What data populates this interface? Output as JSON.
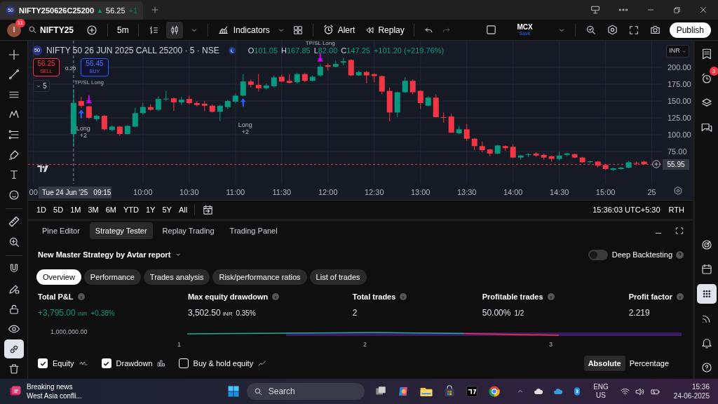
{
  "browser_tab": {
    "badge": "50",
    "title": "NIFTY250626C25200",
    "price": "56.25",
    "change": "+1"
  },
  "toolbar": {
    "avatar_letter": "I",
    "avatar_badge": "11",
    "symbol": "NIFTY25",
    "interval": "5m",
    "indicators": "Indicators",
    "alert": "Alert",
    "replay": "Replay",
    "exchange": "MCX",
    "exchange_sub": "Save",
    "publish": "Publish"
  },
  "left_tools": [
    {
      "selected": false
    },
    {
      "selected": false
    },
    {
      "selected": false
    },
    {
      "selected": false
    },
    {
      "selected": false
    },
    {
      "selected": false
    },
    {
      "selected": false
    },
    {
      "selected": false
    },
    {
      "selected": false
    },
    {
      "selected": false
    },
    {
      "selected": false
    },
    {
      "selected": false
    },
    {
      "selected": false
    },
    {
      "selected": false
    },
    {
      "selected": true
    },
    {
      "selected": false
    }
  ],
  "right_tools": [
    {
      "selected": false
    },
    {
      "selected": false,
      "badge": "3"
    },
    {
      "selected": false
    },
    {
      "selected": false
    },
    {
      "selected": false
    },
    {
      "selected": false
    },
    {
      "selected": true
    },
    {
      "selected": false
    },
    {
      "selected": false
    },
    {
      "selected": false
    }
  ],
  "chart": {
    "header": {
      "badge": "50",
      "symbol": "NIFTY 50 26 JUN 2025 CALL 25200 · 5 · NSE",
      "ohlc": [
        {
          "key": "O",
          "value": "101.05"
        },
        {
          "key": "H",
          "value": "167.85"
        },
        {
          "key": "L",
          "value": "82.00"
        },
        {
          "key": "C",
          "value": "147.25"
        }
      ],
      "change": "+101.20 (+219.76%)"
    },
    "sell": {
      "price": "56.25",
      "label": "SELL"
    },
    "buy": {
      "price": "56.45",
      "label": "BUY"
    },
    "spread": "0.20",
    "study_count": "5",
    "currency": "INR",
    "last_price": "55.95",
    "edge_time_labels": [
      "00",
      "25"
    ],
    "chart_data": {
      "type": "candlestick",
      "ylim": [
        27.1,
        239.6
      ],
      "grid": true,
      "ref_lines": [
        {
          "axis": "y",
          "value": 55.95
        }
      ],
      "yticks": [
        {
          "value": 75,
          "label": "75.00"
        },
        {
          "value": 100,
          "label": "100.00"
        },
        {
          "value": 125,
          "label": "125.00"
        },
        {
          "value": 150,
          "label": "150.00"
        },
        {
          "value": 175,
          "label": "175.00"
        },
        {
          "value": 200,
          "label": "200.00"
        }
      ],
      "categories": [
        null,
        null,
        null,
        null,
        null,
        null,
        null,
        null,
        null,
        "10:00",
        null,
        null,
        null,
        null,
        null,
        "10:30",
        null,
        null,
        null,
        null,
        null,
        "11:00",
        null,
        null,
        null,
        null,
        null,
        "11:30",
        null,
        null,
        null,
        null,
        null,
        "12:00",
        null,
        null,
        null,
        null,
        null,
        "12:30",
        null,
        null,
        null,
        null,
        null,
        "13:00",
        null,
        null,
        null,
        null,
        null,
        "13:30",
        null,
        null,
        null,
        null,
        null,
        "14:00",
        null,
        null,
        null,
        null,
        null,
        "14:30",
        null,
        null,
        null,
        null,
        null,
        "15:00",
        null,
        null,
        null,
        null,
        null
      ],
      "ohlc": [
        [
          101.05,
          167.85,
          82,
          147.25
        ],
        [
          150,
          156,
          140,
          143
        ],
        [
          142,
          143,
          123,
          125
        ],
        [
          123,
          130,
          120,
          128
        ],
        [
          128,
          129,
          106,
          108
        ],
        [
          107,
          114,
          105,
          112
        ],
        [
          112,
          113,
          98,
          101
        ],
        [
          101,
          114,
          100,
          113
        ],
        [
          112,
          140,
          111,
          132
        ],
        [
          132,
          147,
          130,
          141
        ],
        [
          141,
          145,
          136,
          137
        ],
        [
          137,
          157,
          135,
          153
        ],
        [
          153,
          165,
          150,
          153.5
        ],
        [
          154,
          155,
          135,
          148
        ],
        [
          148,
          156,
          144,
          152
        ],
        [
          153,
          158,
          145,
          147
        ],
        [
          147,
          150,
          142,
          144
        ],
        [
          146,
          150,
          135,
          143
        ],
        [
          143,
          145,
          133,
          134
        ],
        [
          134,
          144,
          120,
          143
        ],
        [
          141,
          152,
          138,
          150
        ],
        [
          149,
          161,
          147,
          158
        ],
        [
          158,
          190,
          157,
          179
        ],
        [
          179,
          182,
          170,
          174
        ],
        [
          174,
          190,
          164,
          169
        ],
        [
          169,
          176,
          167,
          173
        ],
        [
          172,
          188,
          170,
          185
        ],
        [
          186,
          189,
          178,
          179
        ],
        [
          180,
          190,
          176,
          177
        ],
        [
          178,
          192,
          176,
          190
        ],
        [
          190,
          192,
          178,
          180
        ],
        [
          180,
          188,
          179,
          186
        ],
        [
          188,
          205,
          186,
          201
        ],
        [
          203,
          206,
          195,
          201
        ],
        [
          201,
          210,
          200,
          205
        ],
        [
          207,
          214,
          203,
          209
        ],
        [
          211,
          212,
          187,
          188
        ],
        [
          188,
          195,
          187,
          193
        ],
        [
          193,
          195,
          176,
          188
        ],
        [
          190,
          191,
          178,
          187
        ],
        [
          187,
          188,
          160,
          164
        ],
        [
          165,
          170,
          120,
          133
        ],
        [
          133,
          164,
          126,
          163
        ],
        [
          163,
          185,
          162,
          180
        ],
        [
          180,
          182,
          160,
          163
        ],
        [
          165,
          166,
          138,
          147
        ],
        [
          143,
          157,
          142,
          155
        ],
        [
          155,
          160,
          126,
          126
        ],
        [
          126,
          133,
          118,
          125
        ],
        [
          127,
          131,
          103,
          103
        ],
        [
          102,
          113,
          101,
          108
        ],
        [
          108,
          116,
          91,
          94
        ],
        [
          94,
          95,
          77,
          83
        ],
        [
          83,
          90,
          74,
          77
        ],
        [
          78,
          79,
          68,
          72
        ],
        [
          72,
          85,
          71,
          84
        ],
        [
          83,
          84,
          76,
          80
        ],
        [
          82,
          86,
          66,
          66
        ],
        [
          66,
          70,
          63,
          69
        ],
        [
          70,
          73,
          67,
          71
        ],
        [
          72,
          74,
          67,
          69
        ],
        [
          70,
          72,
          63,
          66
        ],
        [
          68,
          69,
          60,
          64
        ],
        [
          64,
          75,
          62,
          69
        ],
        [
          70,
          73,
          68,
          72
        ],
        [
          71,
          72,
          65,
          66
        ],
        [
          66,
          67,
          58,
          59
        ],
        [
          60,
          61,
          57,
          60.5
        ],
        [
          60,
          61,
          51,
          54
        ],
        [
          55,
          56,
          48,
          49
        ],
        [
          48,
          51,
          46,
          50
        ],
        [
          49,
          52,
          48,
          51
        ],
        [
          51,
          61,
          50,
          59
        ],
        [
          58,
          60,
          55,
          57
        ],
        [
          60,
          61,
          56,
          56
        ]
      ]
    },
    "crosshair": {
      "date": "Tue 24 Jun '25",
      "time": "09:15"
    },
    "markers": [
      {
        "kind": "entry",
        "label": "Long",
        "qty": "+2"
      },
      {
        "kind": "exit",
        "label": "TP/SL Long"
      },
      {
        "kind": "entry",
        "label": "Long",
        "qty": "+2"
      },
      {
        "kind": "exit",
        "label": "TP/SL Long"
      }
    ]
  },
  "ranges": [
    "1D",
    "5D",
    "1M",
    "3M",
    "6M",
    "YTD",
    "1Y",
    "5Y",
    "All"
  ],
  "clock": "15:36:03 UTC+5:30",
  "session": "RTH",
  "panel": {
    "tabs": [
      {
        "label": "Pine Editor",
        "selected": false
      },
      {
        "label": "Strategy Tester",
        "selected": true
      },
      {
        "label": "Replay Trading",
        "selected": false
      },
      {
        "label": "Trading Panel",
        "selected": false
      }
    ],
    "strategy_name": "New Master Strategy by Avtar report",
    "deep_backtesting": {
      "label": "Deep Backtesting",
      "on": false
    },
    "report_tabs": [
      {
        "label": "Overview",
        "selected": true
      },
      {
        "label": "Performance",
        "selected": false
      },
      {
        "label": "Trades analysis",
        "selected": false
      },
      {
        "label": "Risk/performance ratios",
        "selected": false
      },
      {
        "label": "List of trades",
        "selected": false
      }
    ],
    "metrics": [
      {
        "label": "Total P&L",
        "value": "+3,795.00",
        "unit": "INR",
        "extra": "+0.38%",
        "kind": "gain"
      },
      {
        "label": "Max equity drawdown",
        "value": "3,502.50",
        "unit": "INR",
        "extra": "0.35%",
        "kind": "plain"
      },
      {
        "label": "Total trades",
        "value": "2",
        "kind": "plain"
      },
      {
        "label": "Profitable trades",
        "value": "50.00%",
        "extra": "1/2",
        "kind": "plain"
      },
      {
        "label": "Profit factor",
        "value": "2.219",
        "kind": "plain"
      }
    ],
    "equity_axis": "1,000,000.00",
    "trade_numbers": [
      "1",
      "2",
      "3"
    ],
    "legend": [
      {
        "label": "Equity",
        "checked": true
      },
      {
        "label": "Drawdown",
        "checked": true
      },
      {
        "label": "Buy & hold equity",
        "checked": false
      }
    ],
    "scale_modes": [
      {
        "label": "Absolute",
        "selected": true
      },
      {
        "label": "Percentage",
        "selected": false
      }
    ]
  },
  "taskbar": {
    "news_title": "Breaking news",
    "news_text": "West Asia confli...",
    "search": "Search",
    "language": "ENG",
    "region": "US",
    "time": "15:36",
    "date": "24-06-2025"
  }
}
